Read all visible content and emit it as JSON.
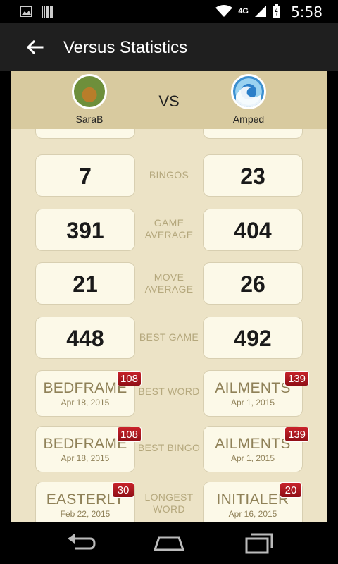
{
  "status_bar": {
    "time": "5:58",
    "network": "4G",
    "icons": [
      "image-icon",
      "barcode-icon",
      "wifi-icon",
      "signal-icon",
      "battery-icon"
    ]
  },
  "app_bar": {
    "title": "Versus Statistics"
  },
  "versus": {
    "player_a": "SaraB",
    "vs_label": "VS",
    "player_b": "Amped"
  },
  "rows": [
    {
      "label": "BINGOS",
      "left": "7",
      "right": "23"
    },
    {
      "label": "GAME AVERAGE",
      "left": "391",
      "right": "404"
    },
    {
      "label": "MOVE AVERAGE",
      "left": "21",
      "right": "26"
    },
    {
      "label": "BEST GAME",
      "left": "448",
      "right": "492"
    }
  ],
  "word_rows": [
    {
      "label": "BEST WORD",
      "left": {
        "word": "BEDFRAME",
        "date": "Apr 18, 2015",
        "score": "108"
      },
      "right": {
        "word": "AILMENTS",
        "date": "Apr 1, 2015",
        "score": "139"
      }
    },
    {
      "label": "BEST BINGO",
      "left": {
        "word": "BEDFRAME",
        "date": "Apr 18, 2015",
        "score": "108"
      },
      "right": {
        "word": "AILMENTS",
        "date": "Apr 1, 2015",
        "score": "139"
      }
    },
    {
      "label": "LONGEST WORD",
      "left": {
        "word": "EASTERLY",
        "date": "Feb 22, 2015",
        "score": "30"
      },
      "right": {
        "word": "INITIALER",
        "date": "Apr 16, 2015",
        "score": "20"
      }
    }
  ],
  "colors": {
    "accent": "#d8ca9f",
    "background": "#ece3c6",
    "badge": "#b81a22"
  }
}
